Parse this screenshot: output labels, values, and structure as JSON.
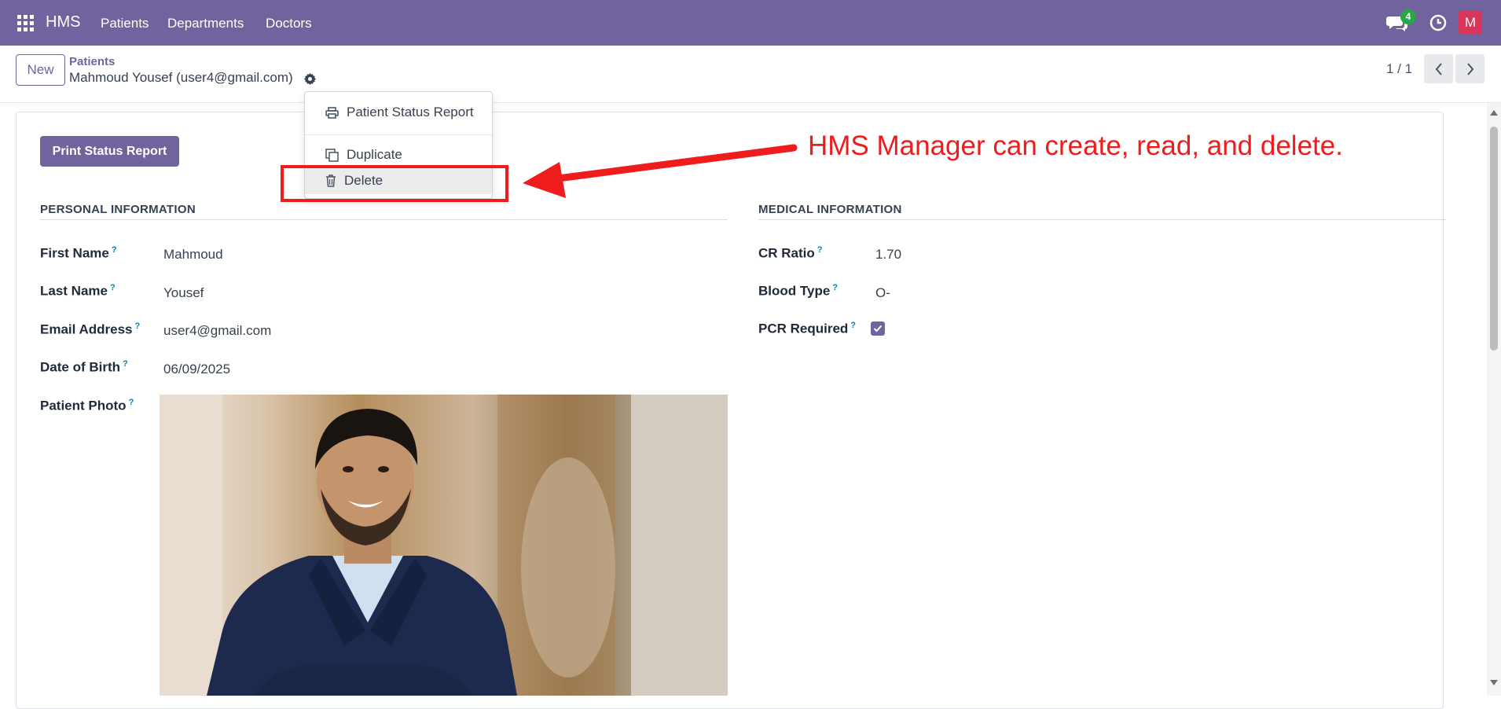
{
  "navbar": {
    "brand": "HMS",
    "menu": [
      "Patients",
      "Departments",
      "Doctors"
    ],
    "chat_count": "4",
    "avatar_letter": "M",
    "icons": {
      "apps": "apps-grid-icon",
      "chat": "chat-icon",
      "clock": "clock-icon"
    }
  },
  "control": {
    "new_label": "New",
    "breadcrumb_parent": "Patients",
    "breadcrumb_current": "Mahmoud Yousef (user4@gmail.com)",
    "pager": "1 / 1"
  },
  "actions_menu": {
    "items": [
      "Patient Status Report",
      "Duplicate",
      "Delete"
    ]
  },
  "form": {
    "print_button": "Print Status Report",
    "personal": {
      "title": "PERSONAL INFORMATION",
      "fields": [
        {
          "label": "First Name",
          "value": "Mahmoud"
        },
        {
          "label": "Last Name",
          "value": "Yousef"
        },
        {
          "label": "Email Address",
          "value": "user4@gmail.com"
        },
        {
          "label": "Date of Birth",
          "value": "06/09/2025"
        },
        {
          "label": "Patient Photo",
          "value": ""
        }
      ]
    },
    "medical": {
      "title": "MEDICAL INFORMATION",
      "fields": [
        {
          "label": "CR Ratio",
          "value": "1.70"
        },
        {
          "label": "Blood Type",
          "value": "O-"
        },
        {
          "label": "PCR Required",
          "checked": true
        }
      ]
    },
    "help_mark": "?"
  },
  "annotation": {
    "text": "HMS Manager can create, read, and delete.",
    "color": "#ee1c1c"
  },
  "colors": {
    "brand": "#71639e",
    "link": "#0180a5"
  }
}
